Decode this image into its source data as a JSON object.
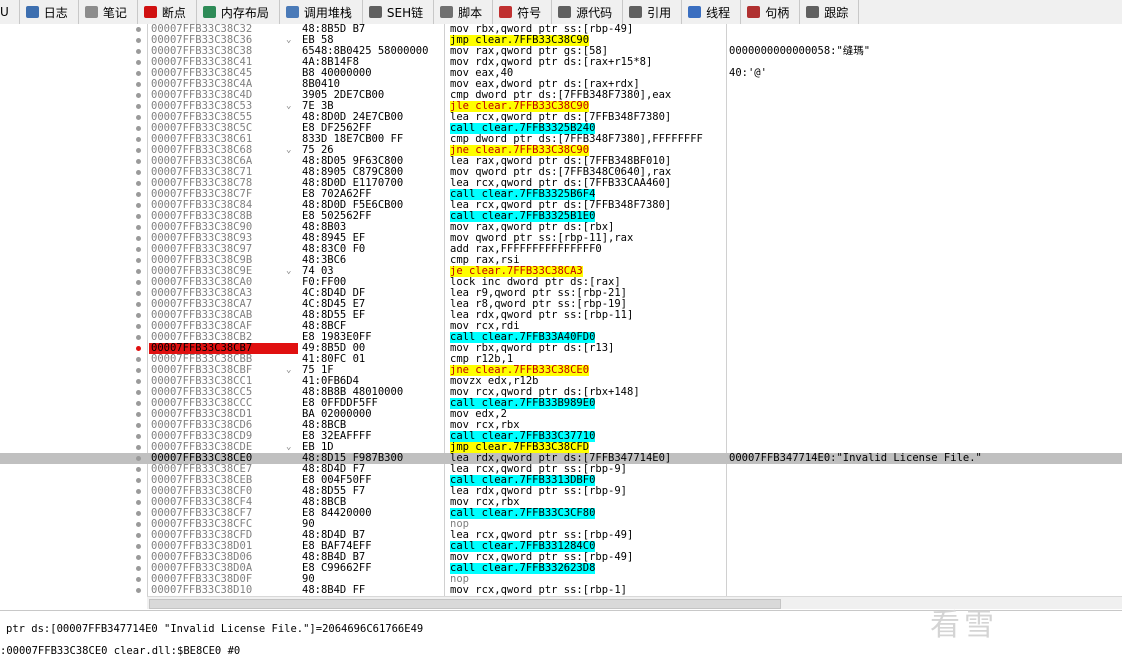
{
  "tabs": [
    {
      "label": "U",
      "icon": "cpu-icon",
      "color": "#7a7a7a"
    },
    {
      "label": "日志",
      "icon": "log-icon",
      "color": "#3d6fb0"
    },
    {
      "label": "笔记",
      "icon": "notes-icon",
      "color": "#8c8c8c"
    },
    {
      "label": "断点",
      "icon": "breakpoint-icon",
      "color": "#d01010"
    },
    {
      "label": "内存布局",
      "icon": "memory-map-icon",
      "color": "#2e8b57"
    },
    {
      "label": "调用堆栈",
      "icon": "call-stack-icon",
      "color": "#4a7ab8"
    },
    {
      "label": "SEH链",
      "icon": "seh-chain-icon",
      "color": "#606060"
    },
    {
      "label": "脚本",
      "icon": "script-icon",
      "color": "#707070"
    },
    {
      "label": "符号",
      "icon": "symbols-icon",
      "color": "#c03030"
    },
    {
      "label": "源代码",
      "icon": "source-icon",
      "color": "#606060"
    },
    {
      "label": "引用",
      "icon": "references-icon",
      "color": "#606060"
    },
    {
      "label": "线程",
      "icon": "threads-icon",
      "color": "#3a6ec0"
    },
    {
      "label": "句柄",
      "icon": "handles-icon",
      "color": "#b03030"
    },
    {
      "label": "跟踪",
      "icon": "trace-icon",
      "color": "#606060"
    }
  ],
  "rows": [
    {
      "addr": "00007FFB33C38C32",
      "bytes": "48:8B5D B7",
      "dis": "mov rbx,qword ptr ss:[rbp-49]",
      "kind": "",
      "cmt": ""
    },
    {
      "addr": "00007FFB33C38C36",
      "bytes": "EB 58",
      "dis": "jmp clear.7FFB33C38C90",
      "kind": "jmp",
      "cmt": "",
      "arrow": "⌄"
    },
    {
      "addr": "00007FFB33C38C38",
      "bytes": "6548:8B0425 58000000",
      "dis": "mov rax,qword ptr gs:[58]",
      "kind": "",
      "cmt": "0000000000000058:\"缝瑪\""
    },
    {
      "addr": "00007FFB33C38C41",
      "bytes": "4A:8B14F8",
      "dis": "mov rdx,qword ptr ds:[rax+r15*8]",
      "kind": "",
      "cmt": ""
    },
    {
      "addr": "00007FFB33C38C45",
      "bytes": "B8 40000000",
      "dis": "mov eax,40",
      "kind": "",
      "cmt": "40:'@'"
    },
    {
      "addr": "00007FFB33C38C4A",
      "bytes": "8B0410",
      "dis": "mov eax,dword ptr ds:[rax+rdx]",
      "kind": "",
      "cmt": ""
    },
    {
      "addr": "00007FFB33C38C4D",
      "bytes": "3905 2DE7CB00",
      "dis": "cmp dword ptr ds:[7FFB348F7380],eax",
      "kind": "",
      "cmt": ""
    },
    {
      "addr": "00007FFB33C38C53",
      "bytes": "7E 3B",
      "dis": "jle clear.7FFB33C38C90",
      "kind": "jcc",
      "cmt": "",
      "arrow": "⌄"
    },
    {
      "addr": "00007FFB33C38C55",
      "bytes": "48:8D0D 24E7CB00",
      "dis": "lea rcx,qword ptr ds:[7FFB348F7380]",
      "kind": "",
      "cmt": ""
    },
    {
      "addr": "00007FFB33C38C5C",
      "bytes": "E8 DF2562FF",
      "dis": "call clear.7FFB3325B240",
      "kind": "call",
      "cmt": ""
    },
    {
      "addr": "00007FFB33C38C61",
      "bytes": "833D 18E7CB00 FF",
      "dis": "cmp dword ptr ds:[7FFB348F7380],FFFFFFFF",
      "kind": "",
      "cmt": ""
    },
    {
      "addr": "00007FFB33C38C68",
      "bytes": "75 26",
      "dis": "jne clear.7FFB33C38C90",
      "kind": "jcc",
      "cmt": "",
      "arrow": "⌄"
    },
    {
      "addr": "00007FFB33C38C6A",
      "bytes": "48:8D05 9F63C800",
      "dis": "lea rax,qword ptr ds:[7FFB348BF010]",
      "kind": "",
      "cmt": ""
    },
    {
      "addr": "00007FFB33C38C71",
      "bytes": "48:8905 C879C800",
      "dis": "mov qword ptr ds:[7FFB348C0640],rax",
      "kind": "",
      "cmt": ""
    },
    {
      "addr": "00007FFB33C38C78",
      "bytes": "48:8D0D E1170700",
      "dis": "lea rcx,qword ptr ds:[7FFB33CAA460]",
      "kind": "",
      "cmt": ""
    },
    {
      "addr": "00007FFB33C38C7F",
      "bytes": "E8 702A62FF",
      "dis": "call clear.7FFB3325B6F4",
      "kind": "call",
      "cmt": ""
    },
    {
      "addr": "00007FFB33C38C84",
      "bytes": "48:8D0D F5E6CB00",
      "dis": "lea rcx,qword ptr ds:[7FFB348F7380]",
      "kind": "",
      "cmt": ""
    },
    {
      "addr": "00007FFB33C38C8B",
      "bytes": "E8 502562FF",
      "dis": "call clear.7FFB3325B1E0",
      "kind": "call",
      "cmt": ""
    },
    {
      "addr": "00007FFB33C38C90",
      "bytes": "48:8B03",
      "dis": "mov rax,qword ptr ds:[rbx]",
      "kind": "",
      "cmt": ""
    },
    {
      "addr": "00007FFB33C38C93",
      "bytes": "48:8945 EF",
      "dis": "mov qword ptr ss:[rbp-11],rax",
      "kind": "",
      "cmt": ""
    },
    {
      "addr": "00007FFB33C38C97",
      "bytes": "48:83C0 F0",
      "dis": "add rax,FFFFFFFFFFFFFFF0",
      "kind": "",
      "cmt": ""
    },
    {
      "addr": "00007FFB33C38C9B",
      "bytes": "48:3BC6",
      "dis": "cmp rax,rsi",
      "kind": "",
      "cmt": ""
    },
    {
      "addr": "00007FFB33C38C9E",
      "bytes": "74 03",
      "dis": "je clear.7FFB33C38CA3",
      "kind": "jcc",
      "cmt": "",
      "arrow": "⌄"
    },
    {
      "addr": "00007FFB33C38CA0",
      "bytes": "F0:FF00",
      "dis": "lock inc dword ptr ds:[rax]",
      "kind": "",
      "cmt": ""
    },
    {
      "addr": "00007FFB33C38CA3",
      "bytes": "4C:8D4D DF",
      "dis": "lea r9,qword ptr ss:[rbp-21]",
      "kind": "",
      "cmt": ""
    },
    {
      "addr": "00007FFB33C38CA7",
      "bytes": "4C:8D45 E7",
      "dis": "lea r8,qword ptr ss:[rbp-19]",
      "kind": "",
      "cmt": ""
    },
    {
      "addr": "00007FFB33C38CAB",
      "bytes": "48:8D55 EF",
      "dis": "lea rdx,qword ptr ss:[rbp-11]",
      "kind": "",
      "cmt": ""
    },
    {
      "addr": "00007FFB33C38CAF",
      "bytes": "48:8BCF",
      "dis": "mov rcx,rdi",
      "kind": "",
      "cmt": ""
    },
    {
      "addr": "00007FFB33C38CB2",
      "bytes": "E8 1983E0FF",
      "dis": "call clear.7FFB33A40FD0",
      "kind": "call",
      "cmt": ""
    },
    {
      "addr": "00007FFB33C38CB7",
      "bytes": "49:8B5D 00",
      "dis": "mov rbx,qword ptr ds:[r13]",
      "kind": "",
      "cmt": "",
      "bp": true
    },
    {
      "addr": "00007FFB33C38CBB",
      "bytes": "41:80FC 01",
      "dis": "cmp r12b,1",
      "kind": "",
      "cmt": ""
    },
    {
      "addr": "00007FFB33C38CBF",
      "bytes": "75 1F",
      "dis": "jne clear.7FFB33C38CE0",
      "kind": "jcc",
      "cmt": "",
      "arrow": "⌄"
    },
    {
      "addr": "00007FFB33C38CC1",
      "bytes": "41:0FB6D4",
      "dis": "movzx edx,r12b",
      "kind": "",
      "cmt": ""
    },
    {
      "addr": "00007FFB33C38CC5",
      "bytes": "48:8B8B 48010000",
      "dis": "mov rcx,qword ptr ds:[rbx+148]",
      "kind": "",
      "cmt": ""
    },
    {
      "addr": "00007FFB33C38CCC",
      "bytes": "E8 0FFDDF5FF",
      "dis": "call clear.7FFB33B989E0",
      "kind": "call",
      "cmt": ""
    },
    {
      "addr": "00007FFB33C38CD1",
      "bytes": "BA 02000000",
      "dis": "mov edx,2",
      "kind": "",
      "cmt": ""
    },
    {
      "addr": "00007FFB33C38CD6",
      "bytes": "48:8BCB",
      "dis": "mov rcx,rbx",
      "kind": "",
      "cmt": ""
    },
    {
      "addr": "00007FFB33C38CD9",
      "bytes": "E8 32EAFFFF",
      "dis": "call clear.7FFB33C37710",
      "kind": "call",
      "cmt": ""
    },
    {
      "addr": "00007FFB33C38CDE",
      "bytes": "EB 1D",
      "dis": "jmp clear.7FFB33C38CFD",
      "kind": "jmp",
      "cmt": "",
      "arrow": "⌄"
    },
    {
      "addr": "00007FFB33C38CE0",
      "bytes": "48:8D15 F987B300",
      "dis": "lea rdx,qword ptr ds:[7FFB347714E0]",
      "kind": "",
      "cmt": "00007FFB347714E0:\"Invalid License File.\"",
      "sel": true
    },
    {
      "addr": "00007FFB33C38CE7",
      "bytes": "48:8D4D F7",
      "dis": "lea rcx,qword ptr ss:[rbp-9]",
      "kind": "",
      "cmt": ""
    },
    {
      "addr": "00007FFB33C38CEB",
      "bytes": "E8 004F50FF",
      "dis": "call clear.7FFB3313DBF0",
      "kind": "call",
      "cmt": ""
    },
    {
      "addr": "00007FFB33C38CF0",
      "bytes": "48:8D55 F7",
      "dis": "lea rdx,qword ptr ss:[rbp-9]",
      "kind": "",
      "cmt": ""
    },
    {
      "addr": "00007FFB33C38CF4",
      "bytes": "48:8BCB",
      "dis": "mov rcx,rbx",
      "kind": "",
      "cmt": ""
    },
    {
      "addr": "00007FFB33C38CF7",
      "bytes": "E8 84420000",
      "dis": "call clear.7FFB33C3CF80",
      "kind": "call",
      "cmt": ""
    },
    {
      "addr": "00007FFB33C38CFC",
      "bytes": "90",
      "dis": "nop",
      "kind": "nop",
      "cmt": ""
    },
    {
      "addr": "00007FFB33C38CFD",
      "bytes": "48:8D4D B7",
      "dis": "lea rcx,qword ptr ss:[rbp-49]",
      "kind": "",
      "cmt": ""
    },
    {
      "addr": "00007FFB33C38D01",
      "bytes": "E8 BAF74EFF",
      "dis": "call clear.7FFB331284C0",
      "kind": "call",
      "cmt": ""
    },
    {
      "addr": "00007FFB33C38D06",
      "bytes": "48:8B4D B7",
      "dis": "mov rcx,qword ptr ss:[rbp-49]",
      "kind": "",
      "cmt": ""
    },
    {
      "addr": "00007FFB33C38D0A",
      "bytes": "E8 C99662FF",
      "dis": "call clear.7FFB332623D8",
      "kind": "call",
      "cmt": ""
    },
    {
      "addr": "00007FFB33C38D0F",
      "bytes": "90",
      "dis": "nop",
      "kind": "nop",
      "cmt": ""
    },
    {
      "addr": "00007FFB33C38D10",
      "bytes": "48:8B4D FF",
      "dis": "mov rcx,qword ptr ss:[rbp-1]",
      "kind": "",
      "cmt": ""
    }
  ],
  "info": {
    "line1": "ptr ds:[00007FFB347714E0 \"Invalid License File.\"]=2064696C61766E49",
    "line2": ":00007FFB33C38CE0 clear.dll:$BE8CE0 #0"
  },
  "watermark": "看雪",
  "colors": {
    "breakpoint": "#e01010",
    "call_highlight": "#00ffff",
    "jump_highlight": "#ffff00",
    "selected_row": "#c0c0c0",
    "jump_line": "#1e90c8"
  }
}
